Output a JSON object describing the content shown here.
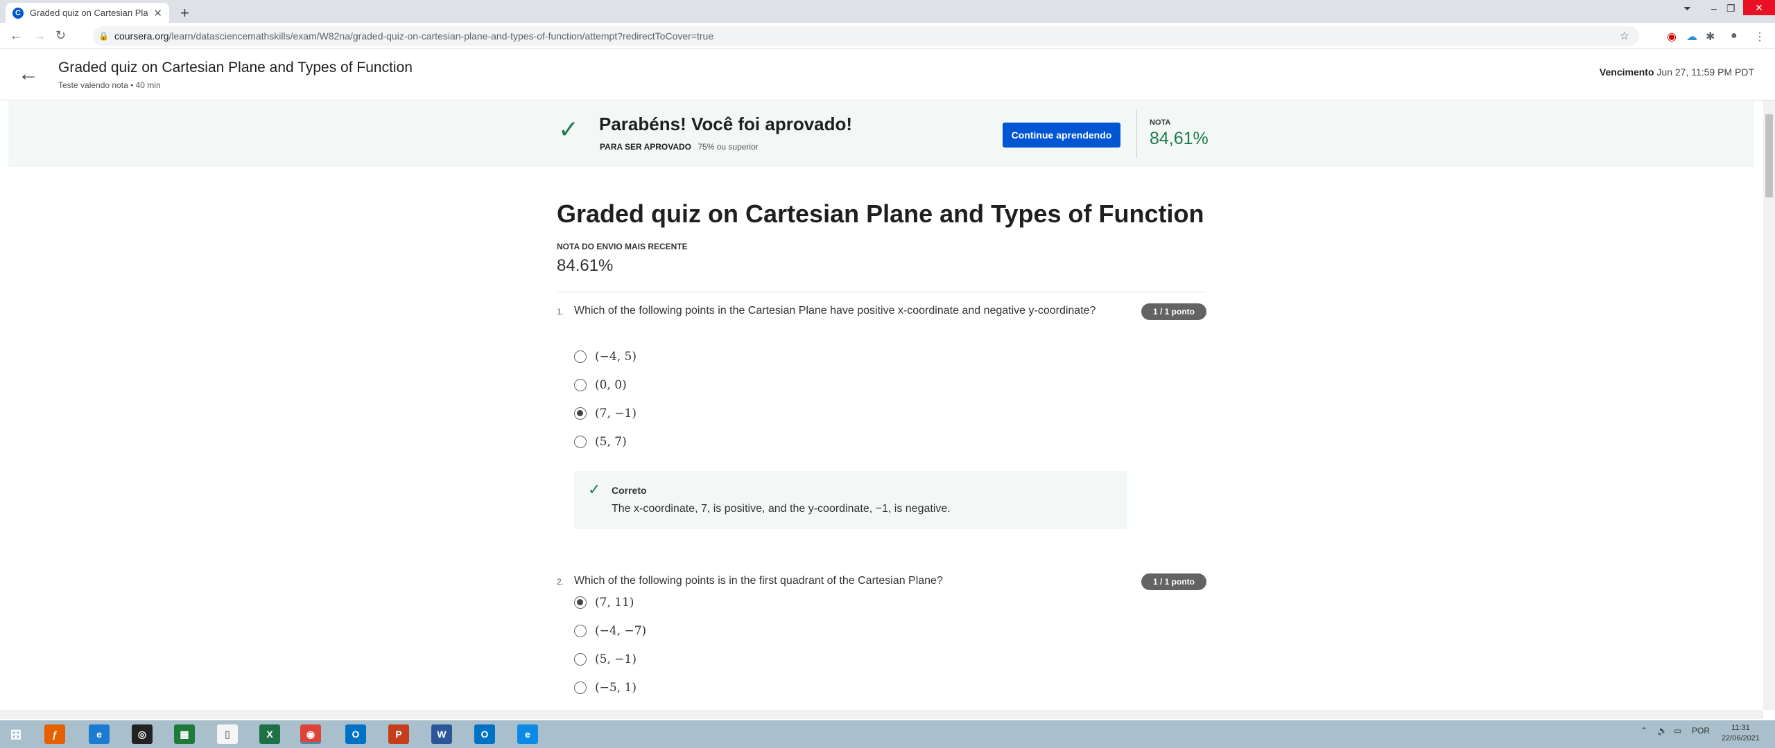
{
  "browser": {
    "tab_title": "Graded quiz on Cartesian Plane and Types of Function",
    "url_host": "coursera.org",
    "url_path": "/learn/datasciencemathskills/exam/W82na/graded-quiz-on-cartesian-plane-and-types-of-function/attempt?redirectToCover=true"
  },
  "header": {
    "title": "Graded quiz on Cartesian Plane and Types of Function",
    "subtitle": "Teste valendo nota • 40 min",
    "due_label": "Vencimento",
    "due_value": "Jun 27, 11:59 PM PDT"
  },
  "banner": {
    "message": "Parabéns! Você foi aprovado!",
    "pass_label": "PARA SER APROVADO",
    "pass_value": "75% ou superior",
    "continue_label": "Continue aprendendo",
    "grade_label": "NOTA",
    "grade_value": "84,61%"
  },
  "main": {
    "title": "Graded quiz on Cartesian Plane and Types of Function",
    "recent_label": "NOTA DO ENVIO MAIS RECENTE",
    "recent_value": "84.61%"
  },
  "questions": [
    {
      "number": "1.",
      "text": "Which of the following points in the Cartesian Plane have positive x-coordinate and negative y-coordinate?",
      "points": "1 / 1 ponto",
      "options": [
        {
          "label": "(−4, 5)",
          "selected": false
        },
        {
          "label": "(0, 0)",
          "selected": false
        },
        {
          "label": "(7, −1)",
          "selected": true
        },
        {
          "label": "(5, 7)",
          "selected": false
        }
      ],
      "feedback": {
        "status": "Correto",
        "explanation": "The x-coordinate, 7, is positive, and the y-coordinate, −1, is negative."
      }
    },
    {
      "number": "2.",
      "text": "Which of the following points is in the first quadrant of the Cartesian Plane?",
      "points": "1 / 1 ponto",
      "options": [
        {
          "label": "(7, 11)",
          "selected": true
        },
        {
          "label": "(−4, −7)",
          "selected": false
        },
        {
          "label": "(5, −1)",
          "selected": false
        },
        {
          "label": "(−5, 1)",
          "selected": false
        }
      ]
    }
  ],
  "taskbar": {
    "language": "POR",
    "time": "11:31",
    "date": "22/06/2021"
  }
}
